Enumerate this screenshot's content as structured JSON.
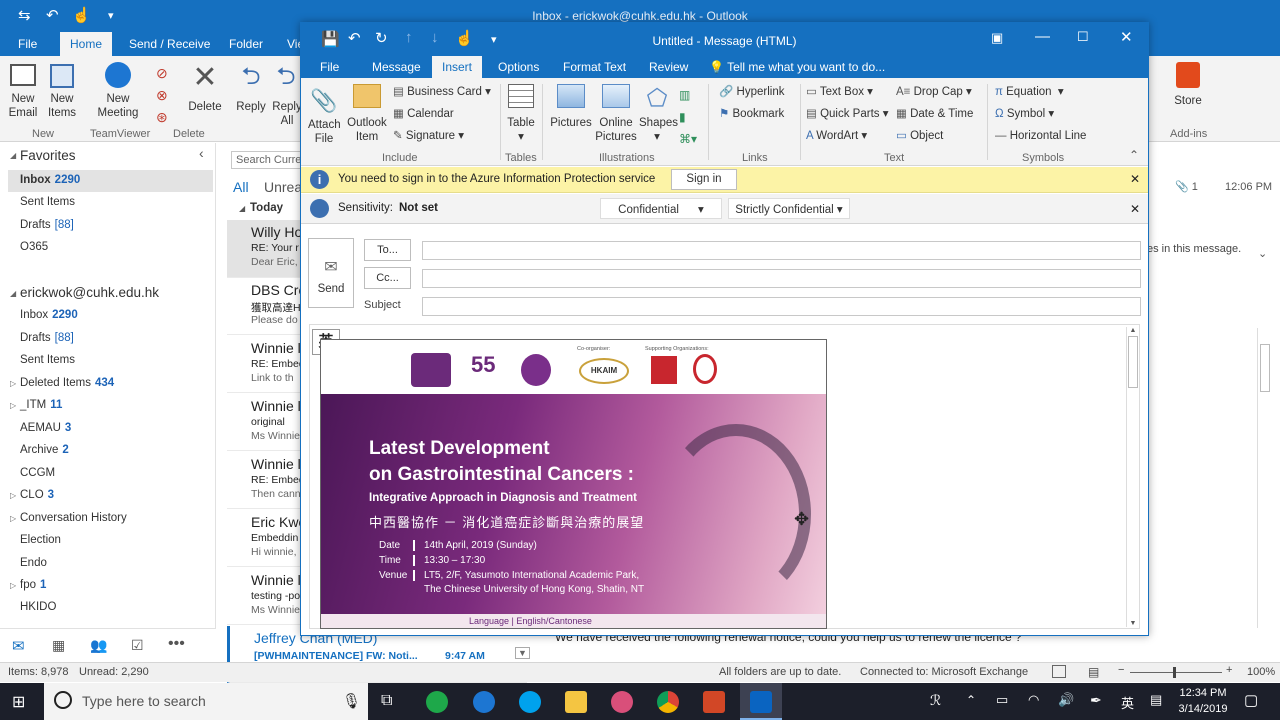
{
  "outlook": {
    "title": "Inbox - erickwok@cuhk.edu.hk - Outlook",
    "tabs": [
      "File",
      "Home",
      "Send / Receive",
      "Folder",
      "Vie"
    ],
    "ribbon": {
      "new_email": "New Email",
      "new_items": "New Items",
      "new_meeting": "New Meeting",
      "group_new": "New",
      "group_teamviewer": "TeamViewer",
      "delete": "Delete",
      "group_delete": "Delete",
      "reply": "Reply",
      "reply_all": "Reply All",
      "store": "Store",
      "group_addins": "Add-ins"
    },
    "favorites_header": "Favorites",
    "favorites": [
      {
        "label": "Inbox",
        "count": "2290"
      },
      {
        "label": "Sent Items",
        "count": ""
      },
      {
        "label": "Drafts",
        "count": "[88]"
      },
      {
        "label": "O365",
        "count": ""
      }
    ],
    "account": "erickwok@cuhk.edu.hk",
    "folders": [
      {
        "label": "Inbox",
        "count": "2290"
      },
      {
        "label": "Drafts",
        "count": "[88]"
      },
      {
        "label": "Sent Items",
        "count": ""
      },
      {
        "label": "Deleted Items",
        "count": "434"
      },
      {
        "label": "_ITM",
        "count": "11"
      },
      {
        "label": "AEMAU",
        "count": "3"
      },
      {
        "label": "Archive",
        "count": "2"
      },
      {
        "label": "CCGM",
        "count": ""
      },
      {
        "label": "CLO",
        "count": "3"
      },
      {
        "label": "Conversation History",
        "count": ""
      },
      {
        "label": "Election",
        "count": ""
      },
      {
        "label": "Endo",
        "count": ""
      },
      {
        "label": "fpo",
        "count": "1"
      },
      {
        "label": "HKIDO",
        "count": ""
      }
    ],
    "search_placeholder": "Search Curre",
    "filter_all": "All",
    "filter_unread": "Unrea",
    "today": "Today",
    "messages": [
      {
        "sender": "Willy Ho",
        "subject": "RE: Your r",
        "preview": "Dear Eric,"
      },
      {
        "sender": "DBS Cre",
        "subject": "獲取高達H",
        "preview": "Please do"
      },
      {
        "sender": "Winnie l",
        "subject": "RE: Embed",
        "preview": "Link to th"
      },
      {
        "sender": "Winnie l",
        "subject": "original",
        "preview": "Ms Winnie"
      },
      {
        "sender": "Winnie l",
        "subject": "RE: Embed",
        "preview": "Then cann"
      },
      {
        "sender": "Eric Kwo",
        "subject": "Embeddin",
        "preview": "Hi winnie,"
      },
      {
        "sender": "Winnie l",
        "subject": "testing -po",
        "preview": "Ms Winnie"
      }
    ],
    "last_message": {
      "sender": "Jeffrey Chan (MED)",
      "subject": "[PWHMAINTENANCE] FW: Noti...",
      "time": "9:47 AM"
    },
    "reading": {
      "attach_count": "1",
      "time": "12:06 PM",
      "info_text": "es in this message.",
      "body_line": "We have received the following renewal notice, could you help us to renew the licence ?"
    },
    "status": {
      "items": "Items: 8,978",
      "unread": "Unread: 2,290",
      "sync": "All folders are up to date.",
      "connection": "Connected to: Microsoft Exchange",
      "zoom": "100%"
    }
  },
  "compose": {
    "title": "Untitled - Message (HTML)",
    "tabs": [
      "File",
      "Message",
      "Insert",
      "Options",
      "Format Text",
      "Review"
    ],
    "tell_me": "Tell me what you want to do...",
    "ribbon": {
      "attach_file": "Attach File",
      "outlook_item": "Outlook Item",
      "business_card": "Business Card",
      "calendar": "Calendar",
      "signature": "Signature",
      "group_include": "Include",
      "table": "Table",
      "group_tables": "Tables",
      "pictures": "Pictures",
      "online_pictures": "Online Pictures",
      "shapes": "Shapes",
      "group_illustrations": "Illustrations",
      "hyperlink": "Hyperlink",
      "bookmark": "Bookmark",
      "group_links": "Links",
      "text_box": "Text Box",
      "quick_parts": "Quick Parts",
      "wordart": "WordArt",
      "drop_cap": "Drop Cap",
      "date_time": "Date & Time",
      "object": "Object",
      "group_text": "Text",
      "equation": "Equation",
      "symbol": "Symbol",
      "horizontal_line": "Horizontal Line",
      "group_symbols": "Symbols"
    },
    "aip_message": "You need to sign in to the Azure Information Protection service",
    "sign_in": "Sign in",
    "sensitivity_label": "Sensitivity:",
    "sensitivity_value": "Not set",
    "confidential": "Confidential",
    "strictly_confidential": "Strictly Confidential",
    "send": "Send",
    "to": "To...",
    "cc": "Cc...",
    "subject": "Subject",
    "ime": "英",
    "flyer": {
      "co_organiser": "Co-organiser:",
      "supporting": "Supporting Organizations:",
      "hkaim": "HKAIM",
      "title1": "Latest Development",
      "title2": "on Gastrointestinal Cancers :",
      "subtitle": "Integrative Approach in Diagnosis and Treatment",
      "chinese": "中西醫協作 － 消化道癌症診斷與治療的展望",
      "date_label": "Date",
      "date": "14th April, 2019 (Sunday)",
      "time_label": "Time",
      "time": "13:30 – 17:30",
      "venue_label": "Venue",
      "venue1": "LT5, 2/F, Yasumoto International Academic Park,",
      "venue2": "The Chinese University of Hong Kong, Shatin, NT",
      "language": "Language  |  English/Cantonese"
    }
  },
  "taskbar": {
    "search_placeholder": "Type here to search",
    "time": "12:34 PM",
    "date": "3/14/2019",
    "ime": "英"
  }
}
